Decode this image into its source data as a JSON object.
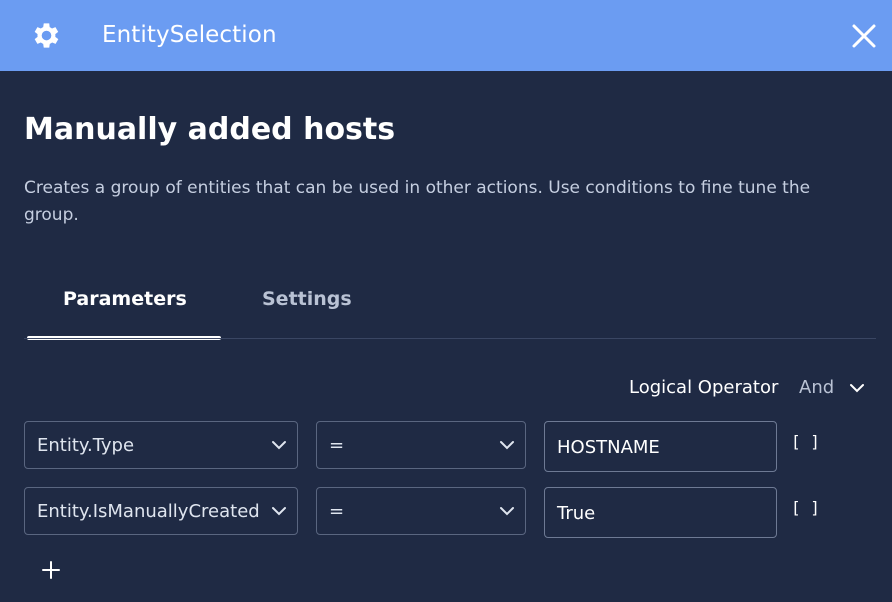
{
  "window": {
    "title": "EntitySelection",
    "settings_icon": "gear-icon",
    "close_icon": "close-icon"
  },
  "content": {
    "heading": "Manually added hosts",
    "description": "Creates a group of entities that can be used in other actions. Use conditions to fine tune the group."
  },
  "tabs": [
    {
      "label": "Parameters",
      "active": true
    },
    {
      "label": "Settings",
      "active": false
    }
  ],
  "logical_operator": {
    "label": "Logical Operator",
    "value": "And"
  },
  "conditions": [
    {
      "field": "Entity.Type",
      "operator": "=",
      "value": "HOSTNAME",
      "brackets": "[ ]"
    },
    {
      "field": "Entity.IsManuallyCreated",
      "operator": "=",
      "value": "True",
      "brackets": "[ ]"
    }
  ],
  "colors": {
    "titlebar": "#6b9cf2",
    "background": "#1f2a44",
    "border": "#5a6680"
  }
}
